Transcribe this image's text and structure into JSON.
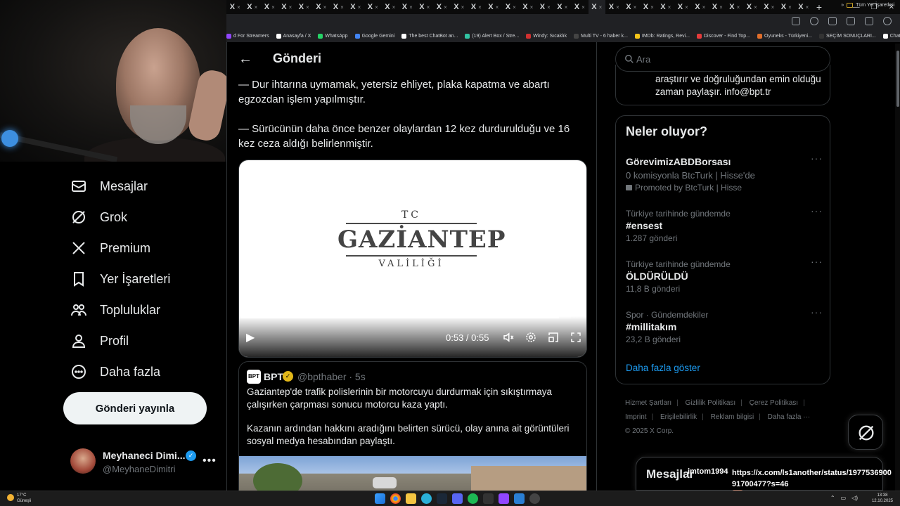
{
  "browser": {
    "tabs_count": 34,
    "tab_icon_label": "X",
    "bookmarks": [
      {
        "label": "d For Streamers",
        "color": "#9146ff"
      },
      {
        "label": "Anasayfa / X",
        "color": "#ffffff"
      },
      {
        "label": "WhatsApp",
        "color": "#25d366"
      },
      {
        "label": "Google Gemini",
        "color": "#4285f4"
      },
      {
        "label": "The best ChatBot an...",
        "color": "#ffffff"
      },
      {
        "label": "(19) Alert Box / Stre...",
        "color": "#31c3a2"
      },
      {
        "label": "Windy: Sıcaklık",
        "color": "#d03030"
      },
      {
        "label": "Multi TV - 6 haber k...",
        "color": "#444444"
      },
      {
        "label": "IMDb: Ratings, Revi...",
        "color": "#f5c518"
      },
      {
        "label": "Discover - Find Top...",
        "color": "#e53b3b"
      },
      {
        "label": "Oyuneks - Türkiyeni...",
        "color": "#e06e2b"
      },
      {
        "label": "SEÇİM SONUÇLARI...",
        "color": "#333333"
      },
      {
        "label": "ChatGPT",
        "color": "#ffffff"
      }
    ],
    "bookmarks_folder": "Tüm Yer İşaretleri"
  },
  "sidebar": {
    "items": [
      {
        "label": "Mesajlar",
        "icon": "envelope-icon"
      },
      {
        "label": "Grok",
        "icon": "grok-icon"
      },
      {
        "label": "Premium",
        "icon": "x-logo-icon"
      },
      {
        "label": "Yer İşaretleri",
        "icon": "bookmark-icon"
      },
      {
        "label": "Topluluklar",
        "icon": "people-icon"
      },
      {
        "label": "Profil",
        "icon": "person-icon"
      },
      {
        "label": "Daha fazla",
        "icon": "more-circle-icon"
      }
    ],
    "post_button": "Gönderi yayınla",
    "account": {
      "name": "Meyhaneci Dimi...",
      "handle": "@MeyhaneDimitri",
      "more": "•••"
    }
  },
  "main": {
    "title": "Gönderi",
    "text": [
      "— Dur ihtarına uymamak, yetersiz ehliyet, plaka kapatma ve abartı egzozdan işlem yapılmıştır.",
      "— Sürücünün daha önce benzer olaylardan 12 kez durdurulduğu ve 16 kez ceza aldığı belirlenmiştir."
    ],
    "video": {
      "logo_top": "TC",
      "logo_main": "GAZİANTEP",
      "logo_sub": "VALİLİĞİ",
      "time": "0:53 / 0:55",
      "progress": 0.964
    },
    "quote": {
      "avatar_text": "BPT",
      "name": "BPT",
      "handle_time": "@bpthaber · 5s",
      "paragraphs": [
        "Gaziantep'de trafik polislerinin bir motorcuyu durdurmak için sıkıştırmaya çalışırken çarpması sonucu motorcu kaza yaptı.",
        "Kazanın ardından hakkını aradığını belirten sürücü, olay anına ait görüntüleri sosyal medya hesabından paylaştı."
      ]
    }
  },
  "right": {
    "search_placeholder": "Ara",
    "bio_text": "araştırır ve doğruluğundan emin olduğu zaman paylaşır. info@bpt.tr",
    "trends_title": "Neler oluyor?",
    "promo": {
      "name": "GörevimizABDBorsası",
      "sub": "0 komisyonla BtcTurk | Hisse'de",
      "tag": "Promoted by BtcTurk | Hisse"
    },
    "trends": [
      {
        "context": "Türkiye tarihinde gündemde",
        "name": "#ensest",
        "count": "1.287 gönderi"
      },
      {
        "context": "Türkiye tarihinde gündemde",
        "name": "ÖLDÜRÜLDÜ",
        "count": "11,8 B gönderi"
      },
      {
        "context": "Spor · Gündemdekiler",
        "name": "#millitakım",
        "count": "23,2 B gönderi"
      }
    ],
    "show_more": "Daha fazla göster",
    "footer_links": [
      "Hizmet Şartları",
      "Gizlilik Politikası",
      "Çerez Politikası",
      "Imprint",
      "Erişilebilirlik",
      "Reklam bilgisi",
      "Daha fazla ···"
    ],
    "copyright": "© 2025 X Corp.",
    "dm_title": "Mesajlar"
  },
  "chat": {
    "user1": "imtom1994",
    "message": "https://x.com/ls1another/status/1977536900 91700477?s=46",
    "user2": "imtom1994"
  },
  "taskbar": {
    "weather_temp": "17°C",
    "weather_desc": "Güneşli",
    "time": "13:38",
    "date": "12.10.2025"
  }
}
